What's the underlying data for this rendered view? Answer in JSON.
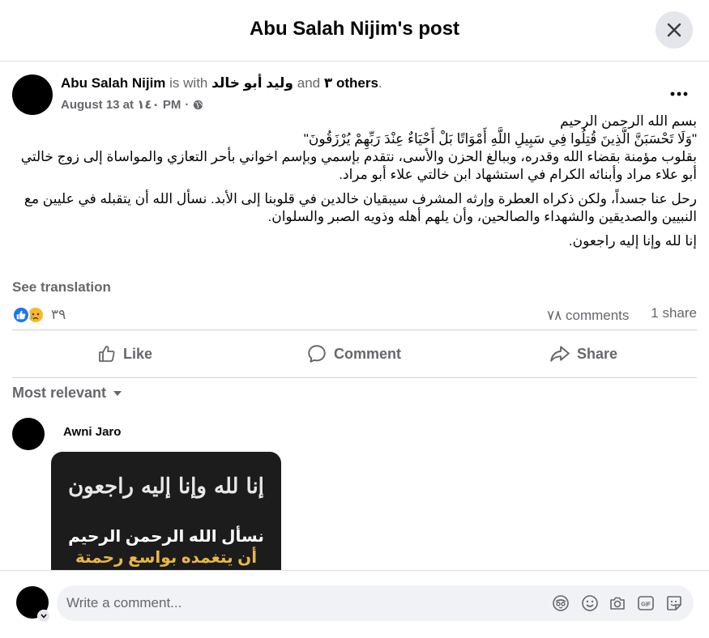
{
  "header": {
    "title": "Abu Salah Nijim's post"
  },
  "post": {
    "author": "Abu Salah Nijim",
    "with_text": "is with",
    "tagged_person": "وليد أبو خالد",
    "and_text": "and",
    "others": "٣ others",
    "period": ".",
    "date": "August 13 at ١٤٠ PM",
    "separator": "·",
    "paragraphs": [
      "بسم الله الرحمن الرحيم\n\"وَلَا تَحْسَبَنَّ الَّذِينَ قُتِلُوا فِي سَبِيلِ اللَّهِ أَمْوَاتًا بَلْ أَحْيَاءٌ عِنْدَ رَبِّهِمْ يُرْزَقُونَ\"\nبقلوب مؤمنة بقضاء الله وقدره، وببالغ الحزن والأسى، نتقدم بإسمي وبإسم اخواني بأحر التعازي والمواساة إلى زوج خالتي أبو علاء مراد وأبنائه الكرام في استشهاد ابن خالتي علاء أبو مراد.",
      "رحل عنا جسداً، ولكن ذكراه العطرة وإرثه المشرف سيبقيان خالدين في قلوبنا إلى الأبد. نسأل الله أن يتقبله في عليين مع النبيين والصديقين والشهداء والصالحين، وأن يلهم أهله وذويه الصبر والسلوان.",
      "إنا لله وإنا إليه راجعون."
    ],
    "see_translation": "See translation",
    "reaction_count": "٣٩",
    "comments_count": "٧٨ comments",
    "shares_count": "1 share"
  },
  "actions": {
    "like": "Like",
    "comment": "Comment",
    "share": "Share"
  },
  "filter": {
    "label": "Most relevant"
  },
  "comment": {
    "author": "Awni Jaro",
    "image_calligraphy": "إنا لله وإنا إليه راجعون",
    "image_line1": "نسأل الله الرحمن الرحيم",
    "image_line2": "أن يتغمده بواسع رحمتة ومغفرته"
  },
  "composer": {
    "placeholder": "Write a comment..."
  },
  "colors": {
    "brand_blue": "#1877f2",
    "sad_yellow": "#f7b928",
    "muted_text": "#65676b",
    "gold_text": "#e8b64a"
  }
}
